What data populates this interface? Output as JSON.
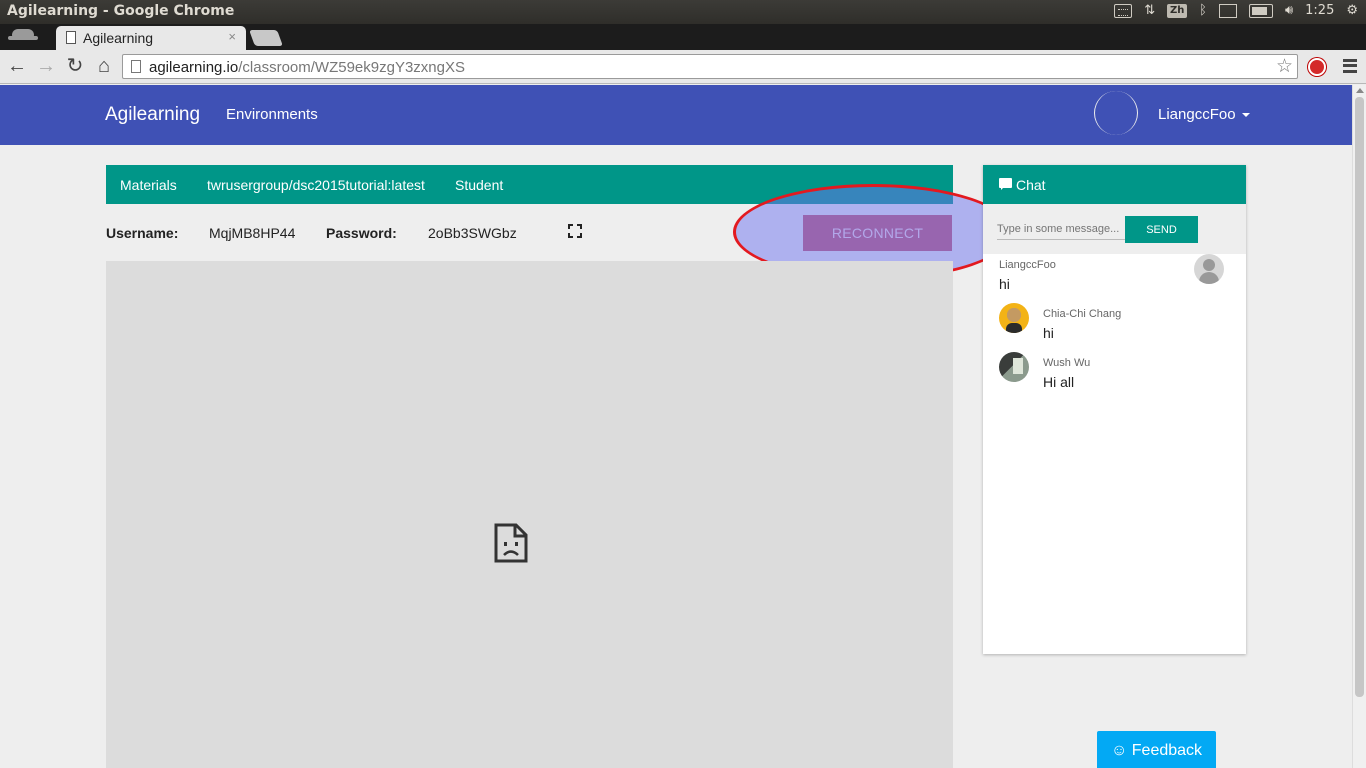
{
  "os": {
    "window_title": "Agilearning - Google Chrome",
    "ime": "Zh",
    "clock": "1:25"
  },
  "browser": {
    "tab_title": "Agilearning",
    "tab_close": "×",
    "url_host": "agilearning.io",
    "url_path": "/classroom/WZ59ek9zgY3zxngXS",
    "star": "☆"
  },
  "navbar": {
    "brand": "Agilearning",
    "environments": "Environments",
    "user": "LiangccFoo"
  },
  "workspace": {
    "tabs": [
      "Materials",
      "twrusergroup/dsc2015tutorial:latest",
      "Student"
    ],
    "username_label": "Username:",
    "username_value": "MqjMB8HP44",
    "password_label": "Password:",
    "password_value": "2oBb3SWGbz",
    "reconnect_label": "RECONNECT"
  },
  "chat": {
    "title": "Chat",
    "input_placeholder": "Type in some message...",
    "send_label": "SEND",
    "messages": [
      {
        "author": "LiangccFoo",
        "text": "hi",
        "avatar": "default-avatar-icon"
      },
      {
        "author": "Chia-Chi Chang",
        "text": "hi",
        "avatar": "user-photo"
      },
      {
        "author": "Wush Wu",
        "text": "Hi all",
        "avatar": "user-photo"
      }
    ]
  },
  "feedback": {
    "icon": "☺",
    "label": "Feedback"
  },
  "colors": {
    "navbar": "#3f51b5",
    "teal": "#009688",
    "reconnect": "#c2566f",
    "highlight_fill": "#6e73f0",
    "highlight_stroke": "#e3191f",
    "feedback": "#03a9f4"
  }
}
